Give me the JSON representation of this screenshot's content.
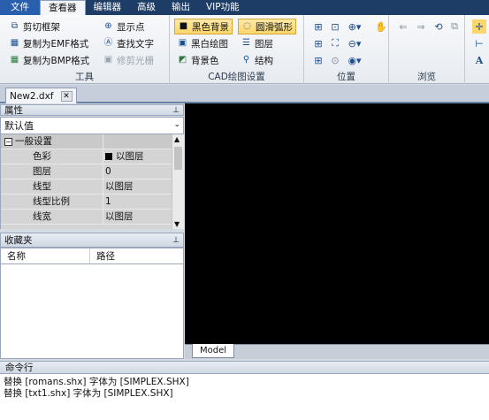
{
  "menu": {
    "file": "文件",
    "viewer": "查看器",
    "editor": "编辑器",
    "advanced": "高级",
    "output": "输出",
    "vip": "VIP功能"
  },
  "ribbon": {
    "tools": {
      "title": "工具",
      "clip_frame": "剪切框架",
      "copy_emf": "复制为EMF格式",
      "copy_bmp": "复制为BMP格式",
      "show_points": "显示点",
      "find_text": "查找文字",
      "trim_raster": "修剪光栅"
    },
    "cad_settings": {
      "title": "CAD绘图设置",
      "black_bg": "黑色背景",
      "smooth_arc": "圆滑弧形",
      "bw_drawing": "黑白绘图",
      "layers": "图层",
      "bg_color": "背景色",
      "structure": "结构"
    },
    "position": {
      "title": "位置"
    },
    "browse": {
      "title": "浏览"
    }
  },
  "document": {
    "tab_name": "New2.dxf"
  },
  "properties": {
    "header": "属性",
    "pin": "ᵖ",
    "preset": "默认值",
    "category": "一般设置",
    "rows": [
      {
        "name": "色彩",
        "value": "以图层",
        "swatch": "#000000"
      },
      {
        "name": "图层",
        "value": "0"
      },
      {
        "name": "线型",
        "value": "以图层"
      },
      {
        "name": "线型比例",
        "value": "1"
      },
      {
        "name": "线宽",
        "value": "以图层"
      }
    ]
  },
  "favorites": {
    "header": "收藏夹",
    "pin": "ᵖ",
    "col_name": "名称",
    "col_path": "路径"
  },
  "canvas": {
    "model_tab": "Model"
  },
  "command": {
    "header": "命令行",
    "lines": [
      "替换 [romans.shx] 字体为 [SIMPLEX.SHX]",
      "替换 [txt1.shx] 字体为 [SIMPLEX.SHX]"
    ]
  }
}
